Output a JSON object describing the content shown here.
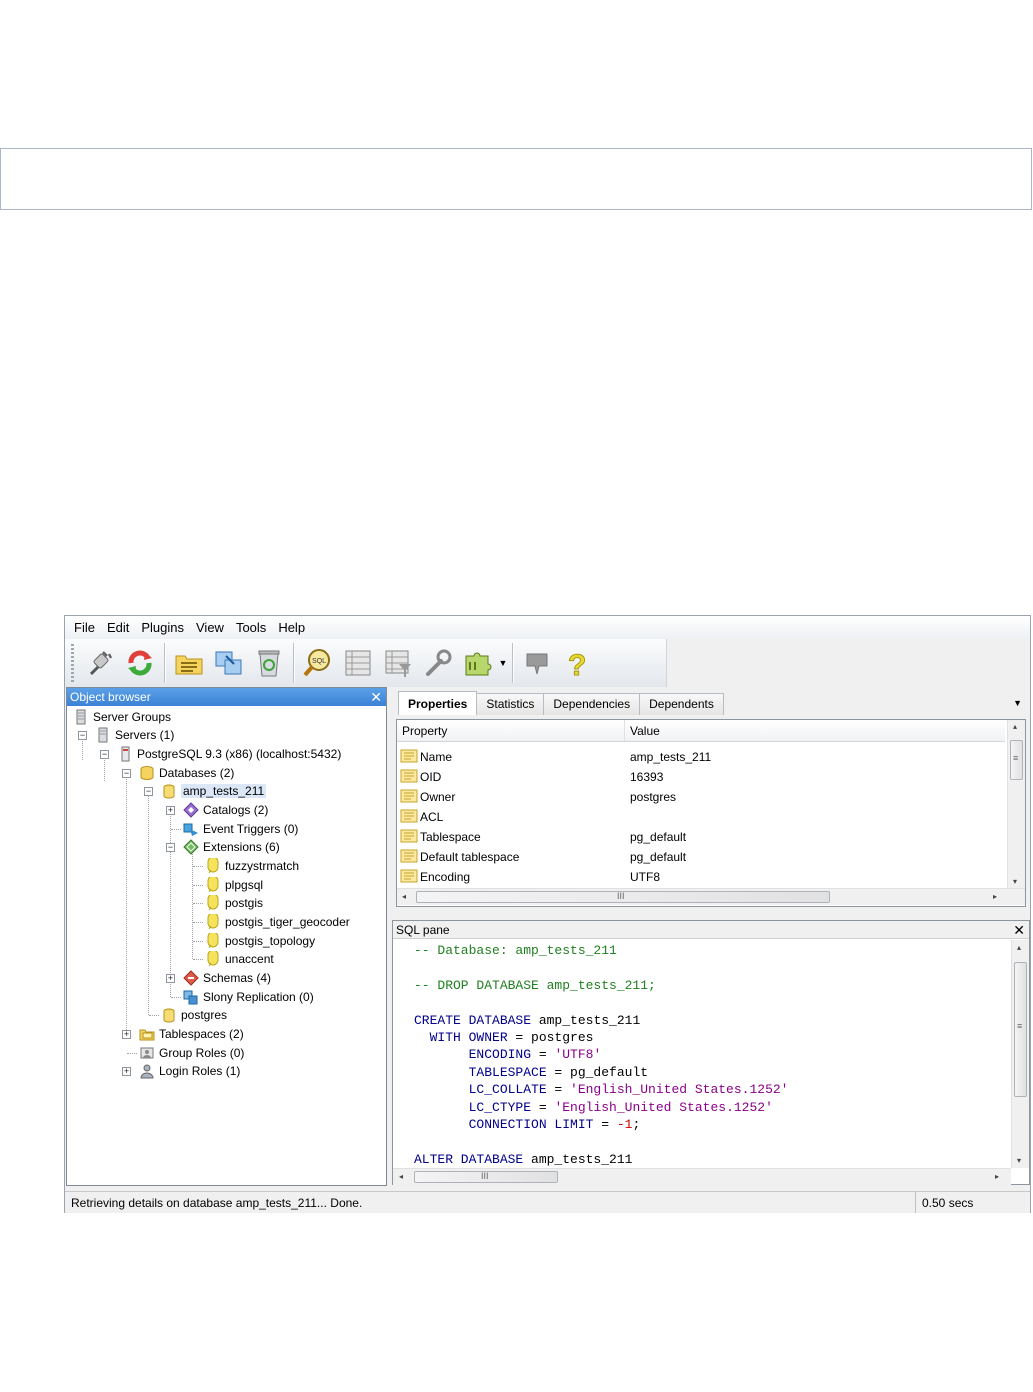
{
  "menu": [
    "File",
    "Edit",
    "Plugins",
    "View",
    "Tools",
    "Help"
  ],
  "toolbar": {
    "buttons": [
      "connect-plug-icon",
      "refresh-icon",
      "properties-folder-icon",
      "create-object-icon",
      "drop-recycle-icon",
      "sql-query-icon",
      "view-data-icon",
      "view-filtered-data-icon",
      "maintenance-wrench-icon",
      "plugins-puzzle-icon",
      "guru-hint-icon",
      "help-icon"
    ]
  },
  "object_browser": {
    "title": "Object browser",
    "close": "✕",
    "items": [
      {
        "label": "Server Groups",
        "icon": "server-groups-icon"
      },
      {
        "label": "Servers (1)",
        "icon": "servers-icon"
      },
      {
        "label": "PostgreSQL 9.3 (x86) (localhost:5432)",
        "icon": "server-icon"
      },
      {
        "label": "Databases (2)",
        "icon": "databases-icon"
      },
      {
        "label": "amp_tests_211",
        "icon": "database-icon"
      },
      {
        "label": "Catalogs (2)",
        "icon": "catalogs-icon"
      },
      {
        "label": "Event Triggers (0)",
        "icon": "event-triggers-icon"
      },
      {
        "label": "Extensions (6)",
        "icon": "extensions-icon"
      },
      {
        "label": "fuzzystrmatch",
        "icon": "extension-icon"
      },
      {
        "label": "plpgsql",
        "icon": "extension-icon"
      },
      {
        "label": "postgis",
        "icon": "extension-icon"
      },
      {
        "label": "postgis_tiger_geocoder",
        "icon": "extension-icon"
      },
      {
        "label": "postgis_topology",
        "icon": "extension-icon"
      },
      {
        "label": "unaccent",
        "icon": "extension-icon"
      },
      {
        "label": "Schemas (4)",
        "icon": "schemas-icon"
      },
      {
        "label": "Slony Replication (0)",
        "icon": "slony-replication-icon"
      },
      {
        "label": "postgres",
        "icon": "database-icon"
      },
      {
        "label": "Tablespaces (2)",
        "icon": "tablespaces-icon"
      },
      {
        "label": "Group Roles (0)",
        "icon": "group-roles-icon"
      },
      {
        "label": "Login Roles (1)",
        "icon": "login-roles-icon"
      }
    ]
  },
  "properties": {
    "tabs": [
      "Properties",
      "Statistics",
      "Dependencies",
      "Dependents"
    ],
    "active_tab": "Properties",
    "columns": [
      "Property",
      "Value"
    ],
    "rows": [
      {
        "property": "Name",
        "value": "amp_tests_211"
      },
      {
        "property": "OID",
        "value": "16393"
      },
      {
        "property": "Owner",
        "value": "postgres"
      },
      {
        "property": "ACL",
        "value": ""
      },
      {
        "property": "Tablespace",
        "value": "pg_default"
      },
      {
        "property": "Default tablespace",
        "value": "pg_default"
      },
      {
        "property": "Encoding",
        "value": "UTF8"
      }
    ]
  },
  "sql_pane": {
    "title": "SQL pane",
    "close": "✕",
    "lines": [
      [
        {
          "t": "-- Database: amp_tests_211",
          "c": "com"
        }
      ],
      [],
      [
        {
          "t": "-- DROP DATABASE amp_tests_211;",
          "c": "com"
        }
      ],
      [],
      [
        {
          "t": "CREATE DATABASE",
          "c": "kw"
        },
        {
          "t": " amp_tests_211",
          "c": ""
        }
      ],
      [
        {
          "t": "  WITH OWNER",
          "c": "kw"
        },
        {
          "t": " = postgres",
          "c": ""
        }
      ],
      [
        {
          "t": "       ENCODING",
          "c": "kw"
        },
        {
          "t": " = ",
          "c": ""
        },
        {
          "t": "'UTF8'",
          "c": "str"
        }
      ],
      [
        {
          "t": "       TABLESPACE",
          "c": "kw"
        },
        {
          "t": " = pg_default",
          "c": ""
        }
      ],
      [
        {
          "t": "       LC_COLLATE",
          "c": "kw"
        },
        {
          "t": " = ",
          "c": ""
        },
        {
          "t": "'English_United States.1252'",
          "c": "str"
        }
      ],
      [
        {
          "t": "       LC_CTYPE",
          "c": "kw"
        },
        {
          "t": " = ",
          "c": ""
        },
        {
          "t": "'English_United States.1252'",
          "c": "str"
        }
      ],
      [
        {
          "t": "       CONNECTION LIMIT",
          "c": "kw"
        },
        {
          "t": " = ",
          "c": ""
        },
        {
          "t": "-1",
          "c": "num"
        },
        {
          "t": ";",
          "c": ""
        }
      ],
      [],
      [
        {
          "t": "ALTER DATABASE",
          "c": "kw"
        },
        {
          "t": " amp_tests_211",
          "c": ""
        }
      ]
    ]
  },
  "status": {
    "message": "Retrieving details on database amp_tests_211... Done.",
    "time": "0.50 secs"
  },
  "scroll": {
    "h_arrow_left": "◂",
    "h_arrow_right": "▸",
    "v_arrow_up": "▴",
    "v_arrow_down": "▾",
    "grip": "≡",
    "h_grip": "III"
  }
}
